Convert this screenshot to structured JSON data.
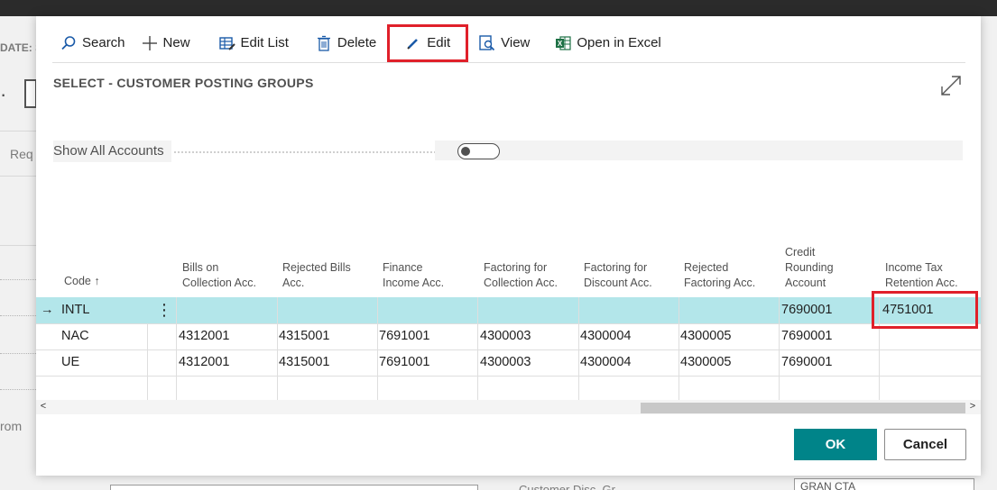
{
  "background": {
    "date_label": "DATE: S",
    "req_label": "Req",
    "from_label": "rom",
    "bottom_label": "Customer Disc. Gr...",
    "bottom_right_value": "GRAN CTA"
  },
  "toolbar": {
    "search_label": "Search",
    "new_label": "New",
    "edit_list_label": "Edit List",
    "delete_label": "Delete",
    "edit_label": "Edit",
    "view_label": "View",
    "excel_label": "Open in Excel"
  },
  "page": {
    "title": "SELECT - CUSTOMER POSTING GROUPS",
    "show_all_label": "Show All Accounts",
    "show_all_value": false
  },
  "grid": {
    "headers": {
      "code": "Code",
      "code_sort": "↑",
      "bills": [
        "Bills on",
        "Collection Acc."
      ],
      "rejected_bills": [
        "Rejected Bills",
        "Acc."
      ],
      "finance": [
        "Finance",
        "Income Acc."
      ],
      "factoring_coll": [
        "Factoring for",
        "Collection Acc."
      ],
      "factoring_disc": [
        "Factoring for",
        "Discount Acc."
      ],
      "rejected_fact": [
        "Rejected",
        "Factoring Acc."
      ],
      "credit": [
        "Credit",
        "Rounding",
        "Account"
      ],
      "income_tax": [
        "Income Tax",
        "Retention Acc."
      ]
    },
    "rows": [
      {
        "code": "INTL",
        "bills": "",
        "rejected_bills": "",
        "finance": "",
        "factoring_coll": "",
        "factoring_disc": "",
        "rejected_fact": "",
        "credit": "7690001",
        "income_tax": "4751001"
      },
      {
        "code": "NAC",
        "bills": "4312001",
        "rejected_bills": "4315001",
        "finance": "7691001",
        "factoring_coll": "4300003",
        "factoring_disc": "4300004",
        "rejected_fact": "4300005",
        "credit": "7690001",
        "income_tax": ""
      },
      {
        "code": "UE",
        "bills": "4312001",
        "rejected_bills": "4315001",
        "finance": "7691001",
        "factoring_coll": "4300003",
        "factoring_disc": "4300004",
        "rejected_fact": "4300005",
        "credit": "7690001",
        "income_tax": ""
      }
    ],
    "row_arrow": "→",
    "row_menu": "⋮"
  },
  "footer": {
    "ok_label": "OK",
    "cancel_label": "Cancel"
  },
  "colors": {
    "accent": "#008489",
    "selected_row": "#b3e6ea",
    "highlight": "#e0202a"
  }
}
